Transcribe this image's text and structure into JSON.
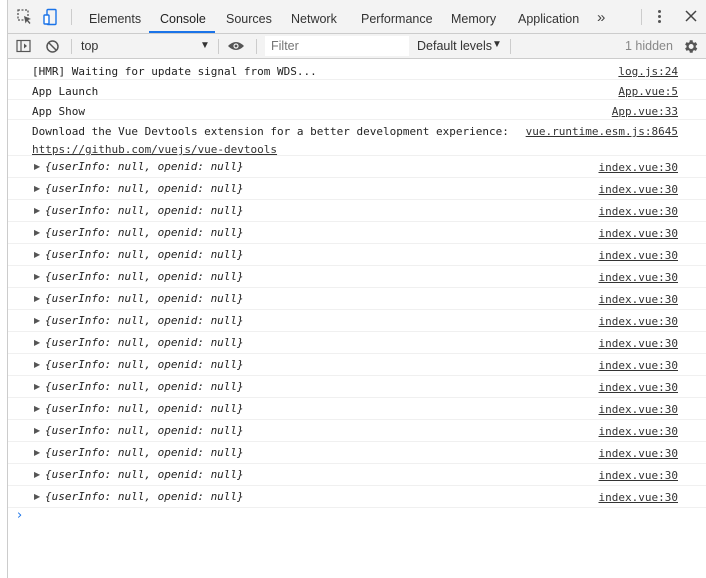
{
  "devtools": {
    "tabs": [
      {
        "label": "Elements"
      },
      {
        "label": "Console"
      },
      {
        "label": "Sources"
      },
      {
        "label": "Network"
      },
      {
        "label": "Performance"
      },
      {
        "label": "Memory"
      },
      {
        "label": "Application"
      }
    ],
    "active_tab": "Console",
    "more_tabs_label": "»"
  },
  "toolbar": {
    "context": "top",
    "filter_placeholder": "Filter",
    "levels": "Default levels",
    "hidden": "1 hidden"
  },
  "messages": [
    {
      "text": "[HMR] Waiting for update signal from WDS...",
      "source": "log.js:24"
    },
    {
      "text": "App Launch",
      "source": "App.vue:5"
    },
    {
      "text": "App Show",
      "source": "App.vue:33"
    },
    {
      "text": "Download the Vue Devtools extension for a better development experience:",
      "link": "https://github.com/vuejs/vue-devtools",
      "source": "vue.runtime.esm.js:8645"
    }
  ],
  "object_logs": [
    {
      "text": "{userInfo: null, openid: null}",
      "source": "index.vue:30"
    },
    {
      "text": "{userInfo: null, openid: null}",
      "source": "index.vue:30"
    },
    {
      "text": "{userInfo: null, openid: null}",
      "source": "index.vue:30"
    },
    {
      "text": "{userInfo: null, openid: null}",
      "source": "index.vue:30"
    },
    {
      "text": "{userInfo: null, openid: null}",
      "source": "index.vue:30"
    },
    {
      "text": "{userInfo: null, openid: null}",
      "source": "index.vue:30"
    },
    {
      "text": "{userInfo: null, openid: null}",
      "source": "index.vue:30"
    },
    {
      "text": "{userInfo: null, openid: null}",
      "source": "index.vue:30"
    },
    {
      "text": "{userInfo: null, openid: null}",
      "source": "index.vue:30"
    },
    {
      "text": "{userInfo: null, openid: null}",
      "source": "index.vue:30"
    },
    {
      "text": "{userInfo: null, openid: null}",
      "source": "index.vue:30"
    },
    {
      "text": "{userInfo: null, openid: null}",
      "source": "index.vue:30"
    },
    {
      "text": "{userInfo: null, openid: null}",
      "source": "index.vue:30"
    },
    {
      "text": "{userInfo: null, openid: null}",
      "source": "index.vue:30"
    },
    {
      "text": "{userInfo: null, openid: null}",
      "source": "index.vue:30"
    },
    {
      "text": "{userInfo: null, openid: null}",
      "source": "index.vue:30"
    }
  ],
  "prompt_glyph": "›",
  "colors": {
    "accent": "#1a73e8",
    "toolbar_bg": "#f3f3f3",
    "border": "#cccccc"
  }
}
